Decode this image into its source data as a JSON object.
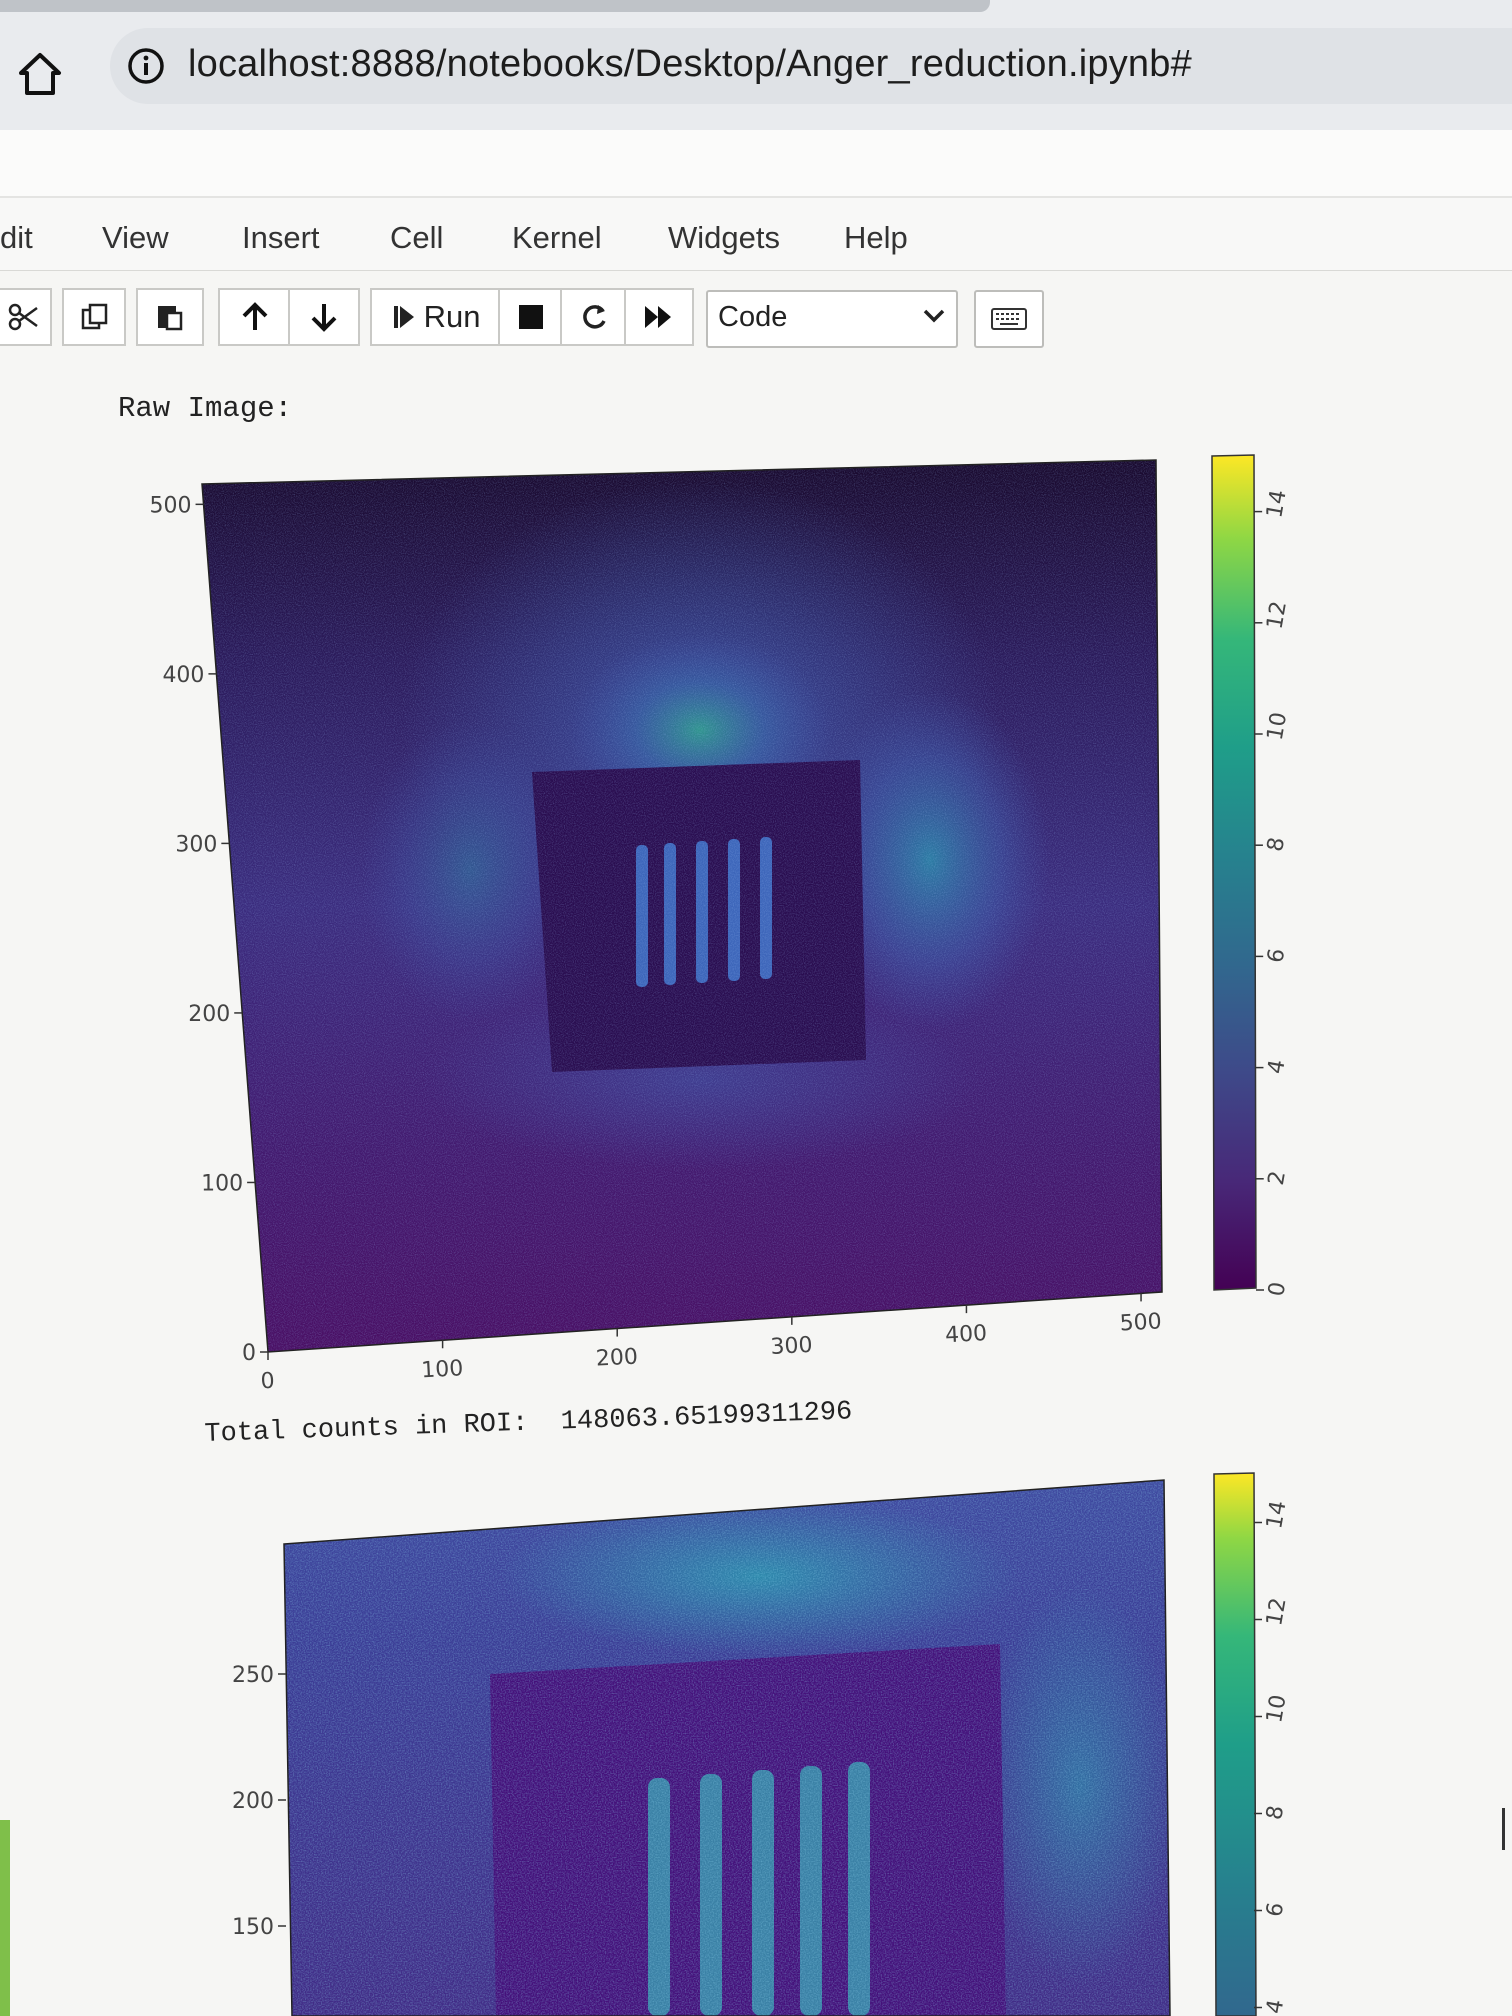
{
  "browser": {
    "url": "localhost:8888/notebooks/Desktop/Anger_reduction.ipynb#"
  },
  "menu": {
    "items": [
      "dit",
      "View",
      "Insert",
      "Cell",
      "Kernel",
      "Widgets",
      "Help"
    ]
  },
  "toolbar": {
    "run_label": "Run",
    "cell_type": "Code",
    "icons": [
      "cut-icon",
      "copy-icon",
      "paste-icon",
      "move-up-icon",
      "move-down-icon",
      "run-icon",
      "stop-icon",
      "restart-icon",
      "fast-forward-icon",
      "keyboard-icon"
    ]
  },
  "output": {
    "raw_label": "Raw Image:",
    "roi_label": "Total counts in ROI:",
    "roi_value": "148063.65199311296"
  },
  "chart_data": [
    {
      "type": "heatmap",
      "title": "",
      "xlabel": "",
      "ylabel": "",
      "xlim": [
        0,
        512
      ],
      "ylim": [
        0,
        512
      ],
      "x_ticks": [
        "0",
        "100",
        "200",
        "300",
        "400",
        "500"
      ],
      "y_ticks": [
        "0",
        "100",
        "200",
        "300",
        "400",
        "500"
      ],
      "colormap": "viridis",
      "colorbar_range": [
        0,
        15
      ],
      "colorbar_ticks": [
        "0",
        "2",
        "4",
        "6",
        "8",
        "10",
        "12",
        "14"
      ],
      "colors": {
        "low": "#440154",
        "mid": "#3b528b",
        "teal": "#21918c",
        "green": "#5ec962",
        "high": "#fde725",
        "dark": "#1a0a2e"
      }
    },
    {
      "type": "heatmap",
      "title": "",
      "xlabel": "",
      "ylabel": "",
      "y_ticks": [
        "150",
        "200",
        "250"
      ],
      "colormap": "viridis",
      "colorbar_range": [
        0,
        15
      ],
      "colorbar_ticks": [
        "4",
        "6",
        "8",
        "10",
        "12",
        "14"
      ]
    }
  ]
}
